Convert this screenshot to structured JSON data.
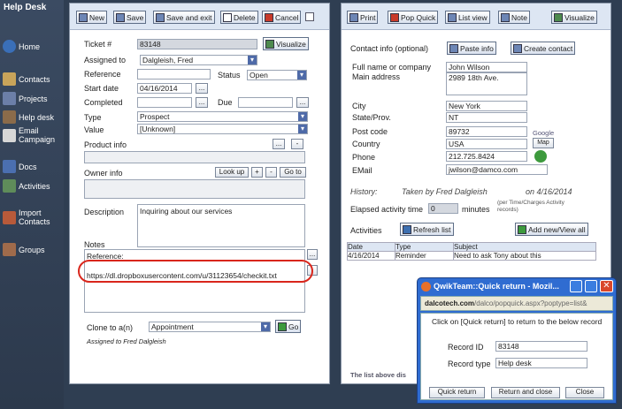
{
  "sidebar": {
    "title": "Help Desk",
    "items": [
      {
        "label": "Home",
        "icon": "home-icon"
      },
      {
        "label": "Contacts",
        "icon": "contacts-icon"
      },
      {
        "label": "Projects",
        "icon": "projects-icon"
      },
      {
        "label": "Help desk",
        "icon": "help-desk-icon"
      },
      {
        "label": "Email Campaign",
        "icon": "email-campaign-icon"
      },
      {
        "label": "Docs",
        "icon": "docs-icon"
      },
      {
        "label": "Activities",
        "icon": "activities-icon"
      },
      {
        "label": "Import Contacts",
        "icon": "import-contacts-icon"
      },
      {
        "label": "Groups",
        "icon": "groups-icon"
      }
    ]
  },
  "left_toolbar": {
    "new": "New",
    "save": "Save",
    "save_exit": "Save and exit",
    "delete": "Delete",
    "cancel": "Cancel"
  },
  "ticket": {
    "ticket_label": "Ticket #",
    "ticket_value": "83148",
    "visualize": "Visualize",
    "assigned_label": "Assigned to",
    "assigned_value": "Dalgleish, Fred",
    "reference_label": "Reference",
    "reference_value": "",
    "status_label": "Status",
    "status_value": "Open",
    "start_label": "Start date",
    "start_value": "04/16/2014",
    "completed_label": "Completed",
    "due_label": "Due",
    "type_label": "Type",
    "type_value": "Prospect",
    "value_label": "Value",
    "value_value": "[Unknown]",
    "product_label": "Product info",
    "owner_label": "Owner info",
    "lookup": "Look up",
    "plus": "+",
    "minus": "-",
    "goto": "Go to",
    "description_label": "Description",
    "description_value": "Inquiring about our services",
    "notes_label": "Notes",
    "reference_note": "Reference:",
    "url": "https://dl.dropboxusercontent.com/u/31123654/checkit.txt",
    "clone_label": "Clone to a(n)",
    "clone_value": "Appointment",
    "go": "Go",
    "assigned_note": "Assigned to Fred Dalgleish",
    "ellipsis": "...",
    "dash": "-"
  },
  "right_toolbar": {
    "print": "Print",
    "pop_quick": "Pop Quick",
    "list_view": "List view",
    "note": "Note",
    "visualize": "Visualize"
  },
  "contact": {
    "header": "Contact info (optional)",
    "paste": "Paste info",
    "create": "Create contact",
    "name_label": "Full name or company",
    "name_value": "John Wilson",
    "address_label": "Main address",
    "address_value": "2989 18th Ave.",
    "city_label": "City",
    "city_value": "New York",
    "state_label": "State/Prov.",
    "state_value": "NT",
    "post_label": "Post code",
    "post_value": "89732",
    "google": "Google",
    "map": "Map",
    "country_label": "Country",
    "country_value": "USA",
    "phone_label": "Phone",
    "phone_value": "212.725.8424",
    "email_label": "EMail",
    "email_value": "jwilson@damco.com"
  },
  "history": {
    "label": "History:",
    "text": "Taken by Fred Dalgleish",
    "date": "on 4/16/2014",
    "elapsed_label": "Elapsed activity time",
    "elapsed_value": "0",
    "minutes": "minutes",
    "note": "(per Time/Charges Activity records)",
    "activities_label": "Activities",
    "refresh": "Refresh list",
    "add_new": "Add new/View all",
    "columns": [
      "Date",
      "Type",
      "Subject"
    ],
    "rows": [
      [
        "4/16/2014",
        "Reminder",
        "Need to ask Tony about this"
      ]
    ],
    "footer": "The list above dis"
  },
  "popup": {
    "title": "QwikTeam::Quick return - Mozil...",
    "address_domain": "dalcotech.com",
    "address_rest": "/dalco/popquick.aspx?poptype=list&",
    "instruction": "Click on [Quick return] to return to the below record",
    "record_id_label": "Record ID",
    "record_id_value": "83148",
    "record_type_label": "Record type",
    "record_type_value": "Help desk",
    "quick_return": "Quick return",
    "return_close": "Return and close",
    "close": "Close"
  },
  "colors": {
    "sidebar": "#2f3e52",
    "highlight_ring": "#d9261c",
    "popup_title": "#2f6cd1"
  }
}
